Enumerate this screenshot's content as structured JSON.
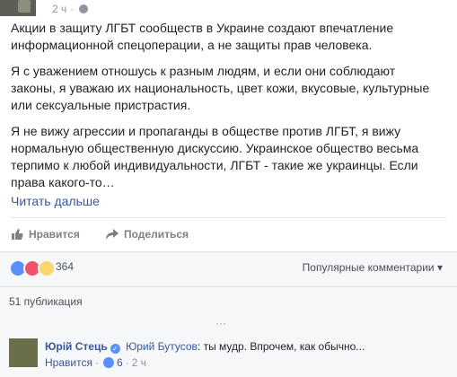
{
  "header": {
    "time": "2 ч",
    "separator": "·"
  },
  "post": {
    "paragraphs": [
      "Акции в защиту ЛГБТ сообществ в Украине создают впечатление информационной спецоперации, а не защиты прав человека.",
      "Я с уважением отношусь к разным людям, и если они соблюдают законы, я уважаю их национальность, цвет кожи, вкусовые, культурные или сексуальные пристрастия.",
      "Я не вижу агрессии и пропаганды в обществе против ЛГБТ, я вижу нормальную общественную дискуссию. Украинское общество весьма терпимо к любой индивидуальности, ЛГБТ - такие же украинцы. Если права какого-то…"
    ],
    "read_more": "Читать дальше"
  },
  "actions": {
    "like": "Нравится",
    "share": "Поделиться"
  },
  "reactions": {
    "count": "364",
    "sort_label": "Популярные комментарии",
    "sort_arrow": "▾"
  },
  "publications": {
    "label": "51 публикация"
  },
  "more_comments": {
    "ellipsis": "···"
  },
  "comment": {
    "author": "Юрій Стець",
    "mention": "Юрий Бутусов",
    "text": ": ты мудр. Впрочем, как обычно...",
    "like_label": "Нравится",
    "separator": "·",
    "likes": "6",
    "time": "2 ч"
  },
  "colors": {
    "link": "#365899",
    "muted": "#90949c",
    "like_blue": "#5890ff",
    "love_red": "#f25268",
    "wow_yellow": "#fcd669",
    "panel_bg": "#f6f7f9"
  }
}
